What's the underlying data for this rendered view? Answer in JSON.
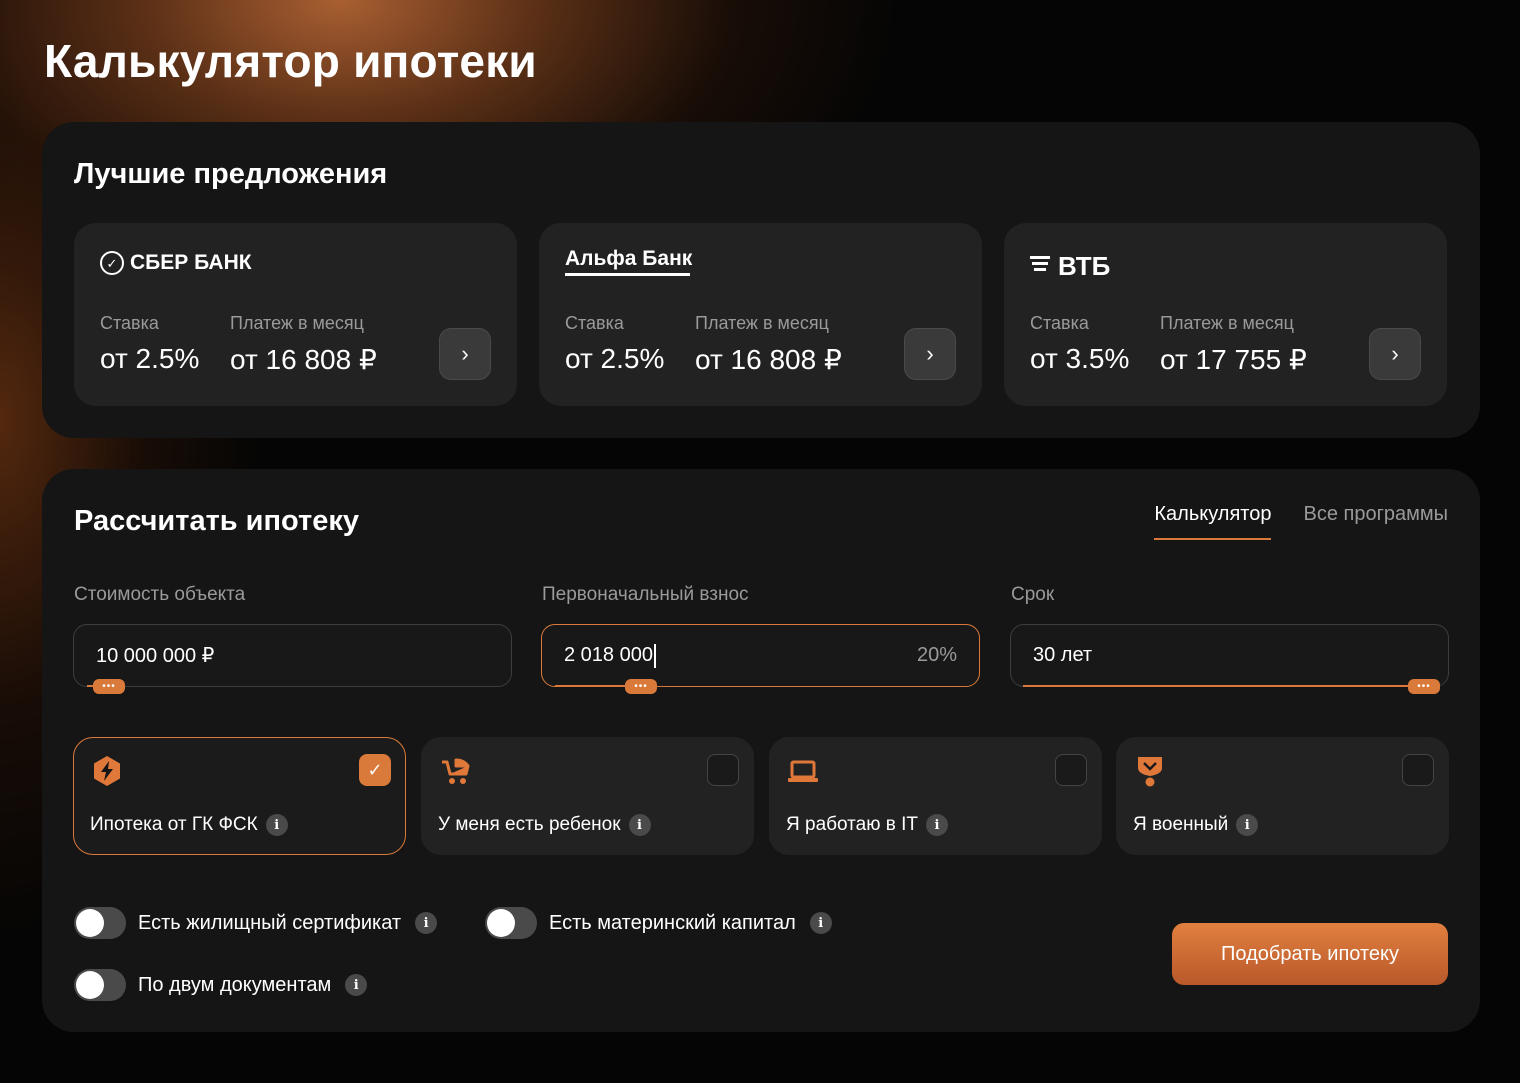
{
  "page": {
    "title": "Калькулятор ипотеки"
  },
  "offers": {
    "title": "Лучшие предложения",
    "cards": [
      {
        "bank": "СБЕР БАНК",
        "logo_icon": "sber-check-icon",
        "rate_label": "Ставка",
        "rate": "от 2.5%",
        "payment_label": "Платеж в месяц",
        "payment": "от 16 808 ₽",
        "arrow": "›"
      },
      {
        "bank": "Альфа Банк",
        "logo_icon": "alfa-a-icon",
        "rate_label": "Ставка",
        "rate": "от 2.5%",
        "payment_label": "Платеж в месяц",
        "payment": "от 16 808 ₽",
        "arrow": "›"
      },
      {
        "bank": "ВТБ",
        "logo_icon": "vtb-lines-icon",
        "rate_label": "Ставка",
        "rate": "от 3.5%",
        "payment_label": "Платеж в месяц",
        "payment": "от 17 755 ₽",
        "arrow": "›"
      }
    ]
  },
  "calculator": {
    "title": "Рассчитать ипотеку",
    "tabs": [
      {
        "label": "Калькулятор",
        "active": true
      },
      {
        "label": "Все программы",
        "active": false
      }
    ],
    "fields": [
      {
        "label": "Стоимость объекта",
        "value": "10 000 000 ₽",
        "suffix": ""
      },
      {
        "label": "Первоначальный взнос",
        "value": "2 018 000",
        "suffix": "20%"
      },
      {
        "label": "Срок",
        "value": "30 лет",
        "suffix": ""
      }
    ],
    "slider_handle_glyph": "•••",
    "slider_levels": [
      0.05,
      0.2,
      1.0
    ],
    "programs": [
      {
        "label": "Ипотека от ГК ФСК",
        "icon": "fsk-logo-icon",
        "checked": true,
        "check_glyph": "✓",
        "info": "i"
      },
      {
        "label": "У меня есть ребенок",
        "icon": "stroller-icon",
        "checked": false,
        "info": "i"
      },
      {
        "label": "Я работаю в IT",
        "icon": "laptop-icon",
        "checked": false,
        "info": "i"
      },
      {
        "label": "Я военный",
        "icon": "military-badge-icon",
        "checked": false,
        "info": "i"
      }
    ],
    "toggles": [
      {
        "label": "Есть жилищный сертификат",
        "on": false,
        "info": "i"
      },
      {
        "label": "Есть материнский капитал",
        "on": false,
        "info": "i"
      },
      {
        "label": "По двум документам",
        "on": false,
        "info": "i"
      }
    ],
    "submit_label": "Подобрать ипотеку"
  },
  "colors": {
    "accent": "#d97a3a",
    "panel": "#151515",
    "card": "#222222",
    "muted": "#9a9a9a"
  }
}
